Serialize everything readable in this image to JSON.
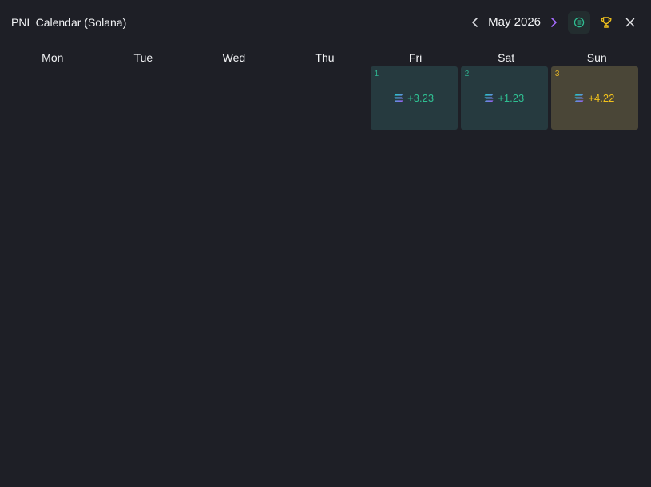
{
  "header": {
    "title": "PNL Calendar (Solana)",
    "month_label": "May 2026"
  },
  "icons": {
    "prev": "chevron-left-icon",
    "next": "chevron-right-icon",
    "currency_toggle": "solana-coin-icon",
    "leaderboard": "trophy-icon",
    "close": "close-icon"
  },
  "colors": {
    "background": "#1e1f26",
    "profit_green": "#2fbf92",
    "best_day_gold": "#f2c21c",
    "next_arrow_purple": "#a66bff"
  },
  "weekdays": [
    "Mon",
    "Tue",
    "Wed",
    "Thu",
    "Fri",
    "Sat",
    "Sun"
  ],
  "days": [
    {
      "day": "1",
      "pnl": "+3.23"
    },
    {
      "day": "2",
      "pnl": "+1.23"
    },
    {
      "day": "3",
      "pnl": "+4.22"
    }
  ]
}
